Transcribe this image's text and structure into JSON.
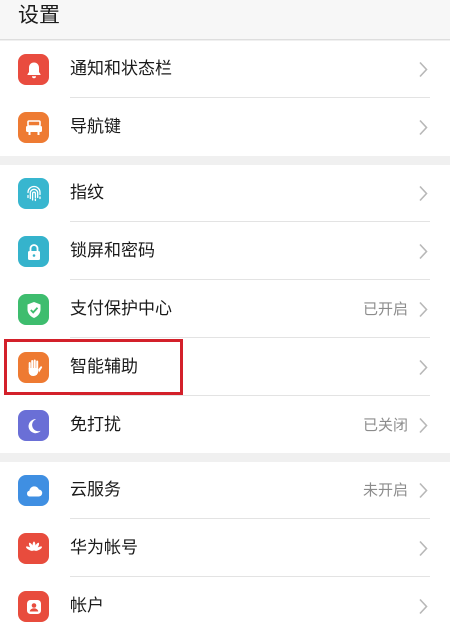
{
  "header": {
    "title": "设置"
  },
  "groups": [
    {
      "items": [
        {
          "label": "通知和状态栏",
          "icon": "bell-icon",
          "icon_color": "#e94c3f"
        },
        {
          "label": "导航键",
          "icon": "navigation-key-icon",
          "icon_color": "#ee7b33"
        }
      ]
    },
    {
      "items": [
        {
          "label": "指纹",
          "icon": "fingerprint-icon",
          "icon_color": "#38b6cf"
        },
        {
          "label": "锁屏和密码",
          "icon": "lock-icon",
          "icon_color": "#35b3cc"
        },
        {
          "label": "支付保护中心",
          "icon": "shield-check-icon",
          "icon_color": "#3ebd6e",
          "status": "已开启"
        },
        {
          "label": "智能辅助",
          "icon": "hand-icon",
          "icon_color": "#ee7a32"
        },
        {
          "label": "免打扰",
          "icon": "moon-icon",
          "icon_color": "#6a6fd6",
          "status": "已关闭"
        }
      ]
    },
    {
      "items": [
        {
          "label": "云服务",
          "icon": "cloud-icon",
          "icon_color": "#3f8fe2",
          "status": "未开启"
        },
        {
          "label": "华为帐号",
          "icon": "huawei-logo-icon",
          "icon_color": "#e84c3d"
        },
        {
          "label": "帐户",
          "icon": "account-icon",
          "icon_color": "#e84c3d"
        }
      ]
    }
  ],
  "highlight_color": "#d3202a"
}
